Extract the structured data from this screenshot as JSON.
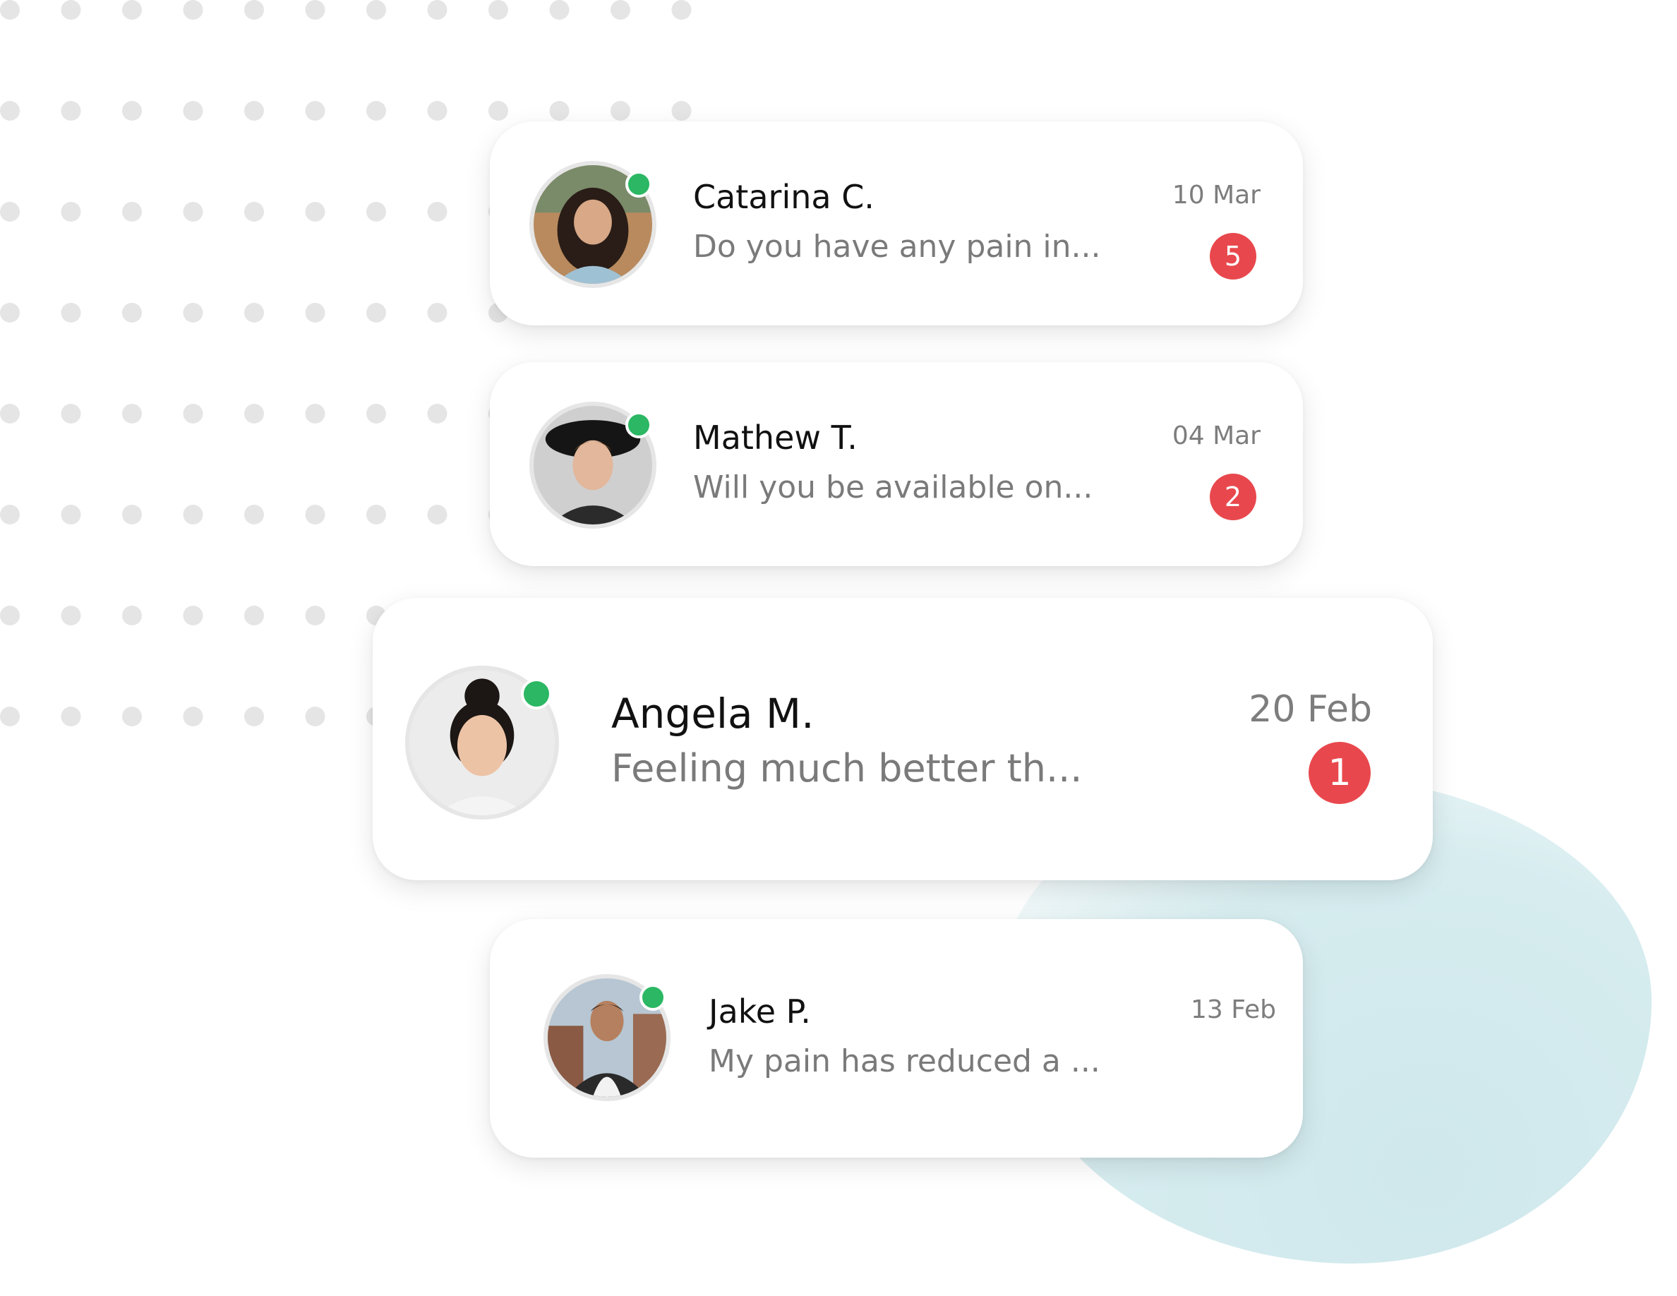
{
  "colors": {
    "online": "#2bb763",
    "badge": "#e8484d",
    "name_text": "#111111",
    "preview_text": "#7a7a7a",
    "date_text": "#7d7d7d",
    "decor_dots": "#e5e5e5",
    "blob": "#d3eaee"
  },
  "conversations": [
    {
      "name": "Catarina C.",
      "preview": "Do you have any pain in...",
      "date": "10 Mar",
      "unread": "5",
      "online": true,
      "avatar_icon": "avatar-photo-woman"
    },
    {
      "name": "Mathew T.",
      "preview": "Will you be available on...",
      "date": "04 Mar",
      "unread": "2",
      "online": true,
      "avatar_icon": "avatar-photo-man-hat"
    },
    {
      "name": "Angela M.",
      "preview": "Feeling much better th...",
      "date": "20 Feb",
      "unread": "1",
      "online": true,
      "avatar_icon": "avatar-photo-woman-bun"
    },
    {
      "name": "Jake P.",
      "preview": "My pain has reduced a ...",
      "date": "13 Feb",
      "unread": "",
      "online": true,
      "avatar_icon": "avatar-photo-man-jacket"
    }
  ]
}
